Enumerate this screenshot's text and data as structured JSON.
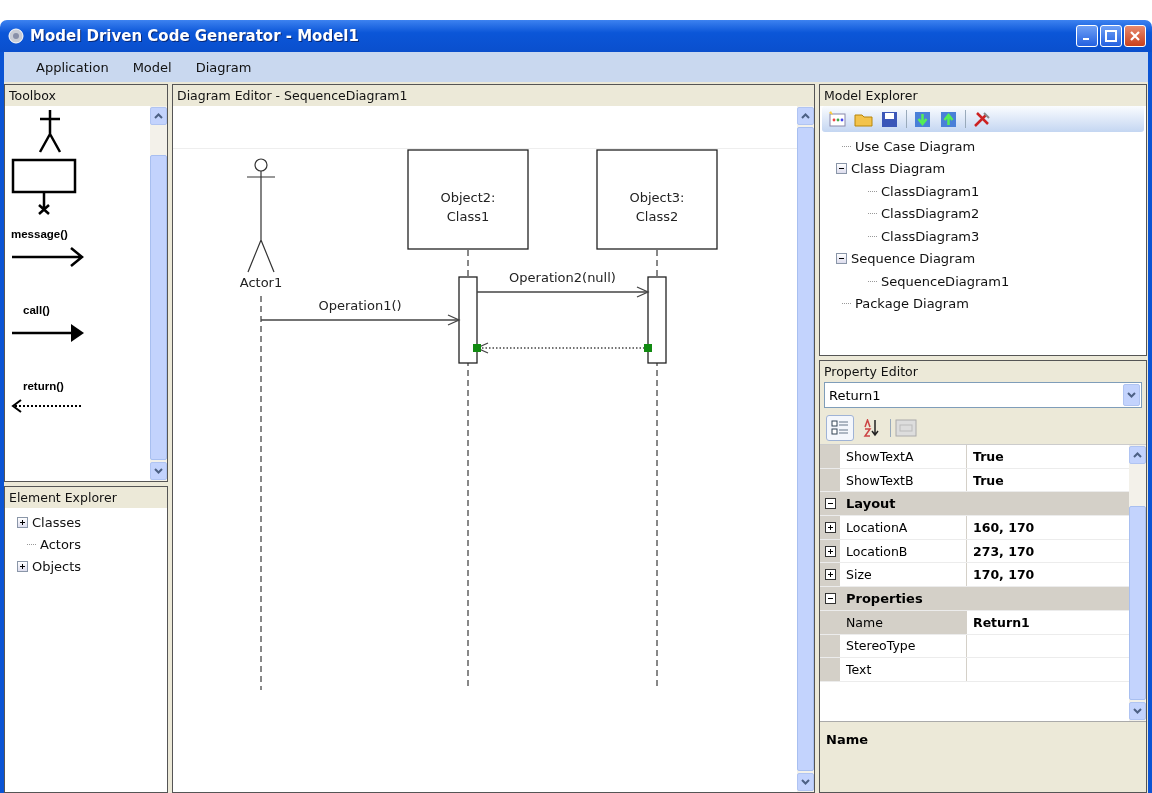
{
  "window": {
    "title": "Model Driven Code Generator - Model1"
  },
  "menu": [
    "Application",
    "Model",
    "Diagram"
  ],
  "toolbox": {
    "title": "Toolbox",
    "items": [
      {
        "kind": "actor"
      },
      {
        "kind": "object"
      },
      {
        "kind": "message",
        "label": "message()"
      },
      {
        "kind": "call",
        "label": "call()"
      },
      {
        "kind": "return",
        "label": "return()"
      }
    ]
  },
  "element_explorer": {
    "title": "Element Explorer",
    "items": [
      {
        "label": "Classes",
        "expandable": true
      },
      {
        "label": "Actors",
        "expandable": false
      },
      {
        "label": "Objects",
        "expandable": true
      }
    ]
  },
  "diagram_editor": {
    "title": "Diagram Editor - SequenceDiagram1",
    "participants": [
      {
        "kind": "actor",
        "label": "Actor1"
      },
      {
        "kind": "object",
        "label": "Object2:\nClass1"
      },
      {
        "kind": "object",
        "label": "Object3:\nClass2"
      }
    ],
    "messages": [
      {
        "kind": "call",
        "label": "Operation1()",
        "selected": false
      },
      {
        "kind": "call",
        "label": "Operation2(null)",
        "selected": false
      },
      {
        "kind": "return",
        "selected": true
      }
    ]
  },
  "model_explorer": {
    "title": "Model Explorer",
    "tree": [
      {
        "label": "Use Case Diagram"
      },
      {
        "label": "Class Diagram",
        "expanded": true,
        "children": [
          {
            "label": "ClassDiagram1"
          },
          {
            "label": "ClassDiagram2"
          },
          {
            "label": "ClassDiagram3"
          }
        ]
      },
      {
        "label": "Sequence Diagram",
        "expanded": true,
        "children": [
          {
            "label": "SequenceDiagram1"
          }
        ]
      },
      {
        "label": "Package Diagram"
      }
    ]
  },
  "property_editor": {
    "title": "Property Editor",
    "object": "Return1",
    "view_buttons": [
      {
        "kind": "categorized",
        "selected": true
      },
      {
        "kind": "alphabetical",
        "selected": false
      }
    ],
    "rows": [
      {
        "kind": "property",
        "name": "ShowTextA",
        "value": "True"
      },
      {
        "kind": "property",
        "name": "ShowTextB",
        "value": "True"
      },
      {
        "kind": "category",
        "name": "Layout",
        "expanded": true
      },
      {
        "kind": "property",
        "name": "LocationA",
        "value": "160, 170",
        "expandable": true
      },
      {
        "kind": "property",
        "name": "LocationB",
        "value": "273, 170",
        "expandable": true
      },
      {
        "kind": "property",
        "name": "Size",
        "value": "170, 170",
        "expandable": true
      },
      {
        "kind": "category",
        "name": "Properties",
        "expanded": true
      },
      {
        "kind": "property",
        "name": "Name",
        "value": "Return1",
        "selected": true
      },
      {
        "kind": "property",
        "name": "StereoType"
      },
      {
        "kind": "property",
        "name": "Text"
      }
    ],
    "description_title": "Name"
  }
}
